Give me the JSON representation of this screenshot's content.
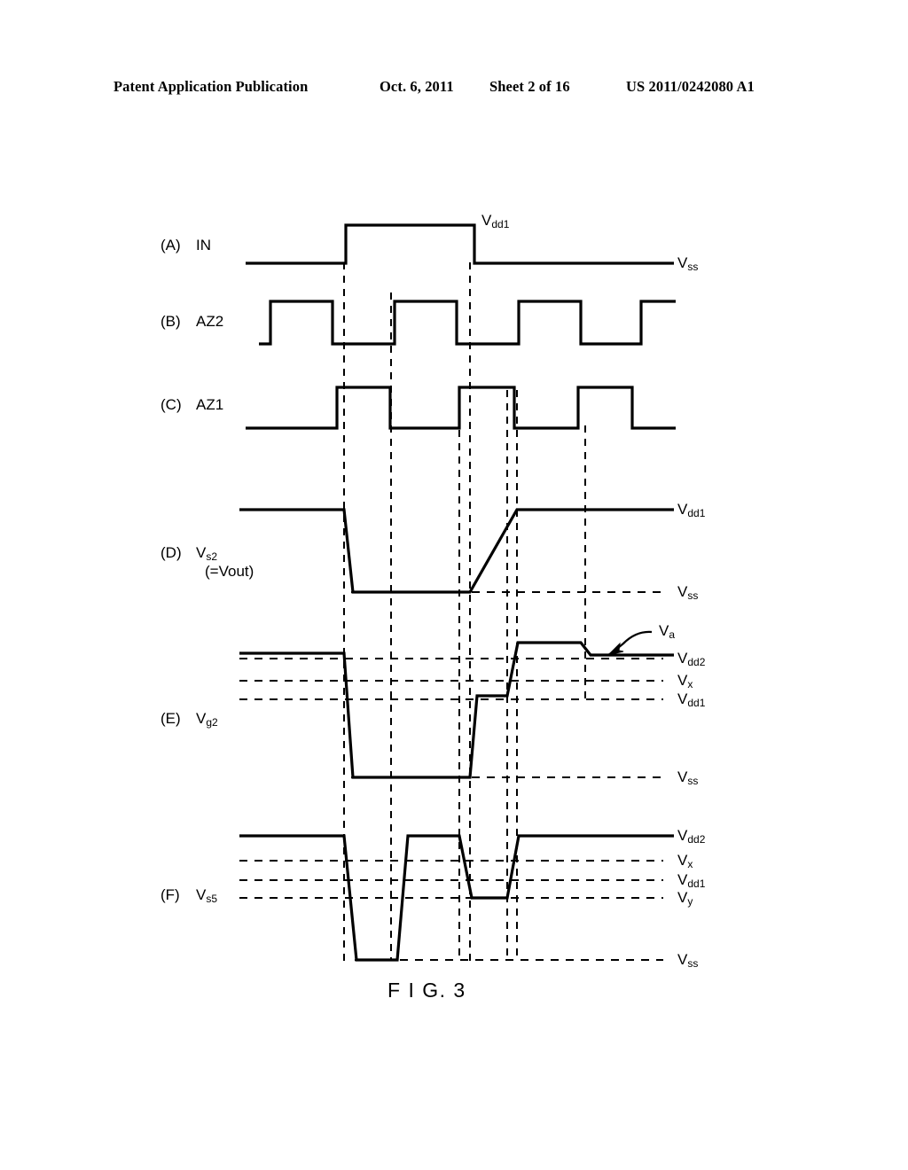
{
  "header": {
    "publication": "Patent Application Publication",
    "date": "Oct. 6, 2011",
    "sheet": "Sheet 2 of 16",
    "patent_number": "US 2011/0242080 A1"
  },
  "figure": {
    "caption": "F I G. 3",
    "rows": [
      {
        "tag": "(A)",
        "name": "IN",
        "name_sub": "",
        "sub_line": ""
      },
      {
        "tag": "(B)",
        "name": "AZ2",
        "name_sub": "",
        "sub_line": ""
      },
      {
        "tag": "(C)",
        "name": "AZ1",
        "name_sub": "",
        "sub_line": ""
      },
      {
        "tag": "(D)",
        "name": "V",
        "name_sub": "s2",
        "sub_line": "(=Vout)"
      },
      {
        "tag": "(E)",
        "name": "V",
        "name_sub": "g2",
        "sub_line": ""
      },
      {
        "tag": "(F)",
        "name": "V",
        "name_sub": "s5",
        "sub_line": ""
      }
    ],
    "level_labels": {
      "in_top": {
        "base": "V",
        "sub": "dd1"
      },
      "a_vss": {
        "base": "V",
        "sub": "ss"
      },
      "d_vdd1": {
        "base": "V",
        "sub": "dd1"
      },
      "d_vss": {
        "base": "V",
        "sub": "ss"
      },
      "e_va": {
        "base": "V",
        "sub": "a"
      },
      "e_vdd2": {
        "base": "V",
        "sub": "dd2"
      },
      "e_vx": {
        "base": "V",
        "sub": "x"
      },
      "e_vdd1": {
        "base": "V",
        "sub": "dd1"
      },
      "e_vss": {
        "base": "V",
        "sub": "ss"
      },
      "f_vdd2": {
        "base": "V",
        "sub": "dd2"
      },
      "f_vx": {
        "base": "V",
        "sub": "x"
      },
      "f_vdd1": {
        "base": "V",
        "sub": "dd1"
      },
      "f_vy": {
        "base": "V",
        "sub": "y"
      },
      "f_vss": {
        "base": "V",
        "sub": "ss"
      }
    }
  },
  "chart_data": {
    "type": "line",
    "title": "F I G. 3",
    "description": "Timing waveform diagram of six signals versus time",
    "xlabel": "time",
    "ylabel": "voltage",
    "grid": "vertical dashed marker lines",
    "legend": "none",
    "time_markers": [
      388,
      441,
      518,
      530,
      572,
      583
    ],
    "plot_x_range": [
      275,
      760
    ],
    "series": [
      {
        "name": "(A) IN",
        "levels": {
          "high": "Vdd1",
          "low": "Vss"
        },
        "points": [
          [
            275,
            "Vss"
          ],
          [
            390,
            "Vss"
          ],
          [
            390,
            "Vdd1"
          ],
          [
            535,
            "Vdd1"
          ],
          [
            535,
            "Vss"
          ],
          [
            760,
            "Vss"
          ]
        ]
      },
      {
        "name": "(B) AZ2",
        "levels": {
          "high": "high",
          "low": "low"
        },
        "points": [
          [
            292,
            "low"
          ],
          [
            305,
            "low"
          ],
          [
            305,
            "high"
          ],
          [
            375,
            "high"
          ],
          [
            375,
            "low"
          ],
          [
            445,
            "low"
          ],
          [
            445,
            "high"
          ],
          [
            515,
            "high"
          ],
          [
            515,
            "low"
          ],
          [
            585,
            "low"
          ],
          [
            585,
            "high"
          ],
          [
            655,
            "high"
          ],
          [
            655,
            "low"
          ],
          [
            723,
            "low"
          ],
          [
            723,
            "high"
          ],
          [
            760,
            "high"
          ]
        ]
      },
      {
        "name": "(C) AZ1",
        "levels": {
          "high": "high",
          "low": "low"
        },
        "points": [
          [
            278,
            "low"
          ],
          [
            380,
            "low"
          ],
          [
            380,
            "high"
          ],
          [
            440,
            "high"
          ],
          [
            440,
            "low"
          ],
          [
            518,
            "low"
          ],
          [
            518,
            "high"
          ],
          [
            580,
            "high"
          ],
          [
            580,
            "low"
          ],
          [
            652,
            "low"
          ],
          [
            652,
            "high"
          ],
          [
            713,
            "high"
          ],
          [
            713,
            "low"
          ],
          [
            760,
            "low"
          ]
        ]
      },
      {
        "name": "(D) Vs2 (=Vout)",
        "levels": {
          "high": "Vdd1",
          "low": "Vss"
        },
        "points": [
          [
            275,
            "Vdd1"
          ],
          [
            388,
            "Vdd1"
          ],
          [
            395,
            "Vss"
          ],
          [
            530,
            "Vss"
          ],
          [
            583,
            "Vdd1"
          ],
          [
            760,
            "Vdd1"
          ]
        ]
      },
      {
        "name": "(E) Vg2",
        "levels": {
          "top": "above Vdd2",
          "va": "Va",
          "mid": "near Vdd1",
          "low": "Vss"
        },
        "points": [
          [
            275,
            "above Vdd2"
          ],
          [
            388,
            "above Vdd2"
          ],
          [
            396,
            "Vss"
          ],
          [
            530,
            "Vss"
          ],
          [
            537,
            "near Vdd1"
          ],
          [
            572,
            "near Vdd1"
          ],
          [
            583,
            "above Vdd2"
          ],
          [
            655,
            "above Vdd2"
          ],
          [
            665,
            "Va"
          ],
          [
            760,
            "Va"
          ]
        ]
      },
      {
        "name": "(F) Vs5",
        "levels": {
          "high": "Vdd2",
          "mid": "Vy",
          "low": "Vss"
        },
        "points": [
          [
            275,
            "Vdd2"
          ],
          [
            388,
            "Vdd2"
          ],
          [
            400,
            "Vss"
          ],
          [
            448,
            "Vss"
          ],
          [
            460,
            "Vdd2"
          ],
          [
            518,
            "Vdd2"
          ],
          [
            530,
            "Vy"
          ],
          [
            572,
            "Vy"
          ],
          [
            583,
            "Vdd2"
          ],
          [
            760,
            "Vdd2"
          ]
        ]
      }
    ],
    "annotations": [
      {
        "text": "Vdd1",
        "target": "top of (A) IN pulse"
      },
      {
        "text": "Va",
        "target": "final level of (E) Vg2 after step down"
      }
    ]
  }
}
